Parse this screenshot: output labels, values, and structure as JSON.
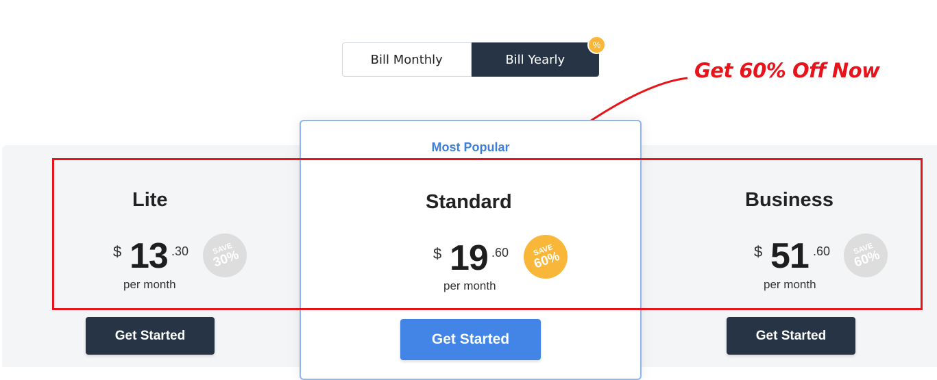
{
  "billing_toggle": {
    "monthly_label": "Bill Monthly",
    "yearly_label": "Bill Yearly",
    "selected": "Bill Yearly",
    "badge": "%"
  },
  "annotation": {
    "text": "Get 60% Off Now",
    "color": "#e8141c"
  },
  "plans": [
    {
      "name": "Lite",
      "currency": "$",
      "amount": "13",
      "cents": ".30",
      "period": "per month",
      "save_top": "SAVE",
      "save_value": "30%",
      "cta": "Get Started"
    },
    {
      "name": "Standard",
      "tag": "Most Popular",
      "currency": "$",
      "amount": "19",
      "cents": ".60",
      "period": "per month",
      "save_top": "SAVE",
      "save_value": "60%",
      "cta": "Get Started"
    },
    {
      "name": "Business",
      "currency": "$",
      "amount": "51",
      "cents": ".60",
      "period": "per month",
      "save_top": "SAVE",
      "save_value": "60%",
      "cta": "Get Started"
    }
  ],
  "colors": {
    "dark_navy": "#263445",
    "primary_blue": "#4285e6",
    "accent_gold": "#f9b73a",
    "popular_blue": "#3f7fdc",
    "band_gray": "#f4f5f7"
  }
}
